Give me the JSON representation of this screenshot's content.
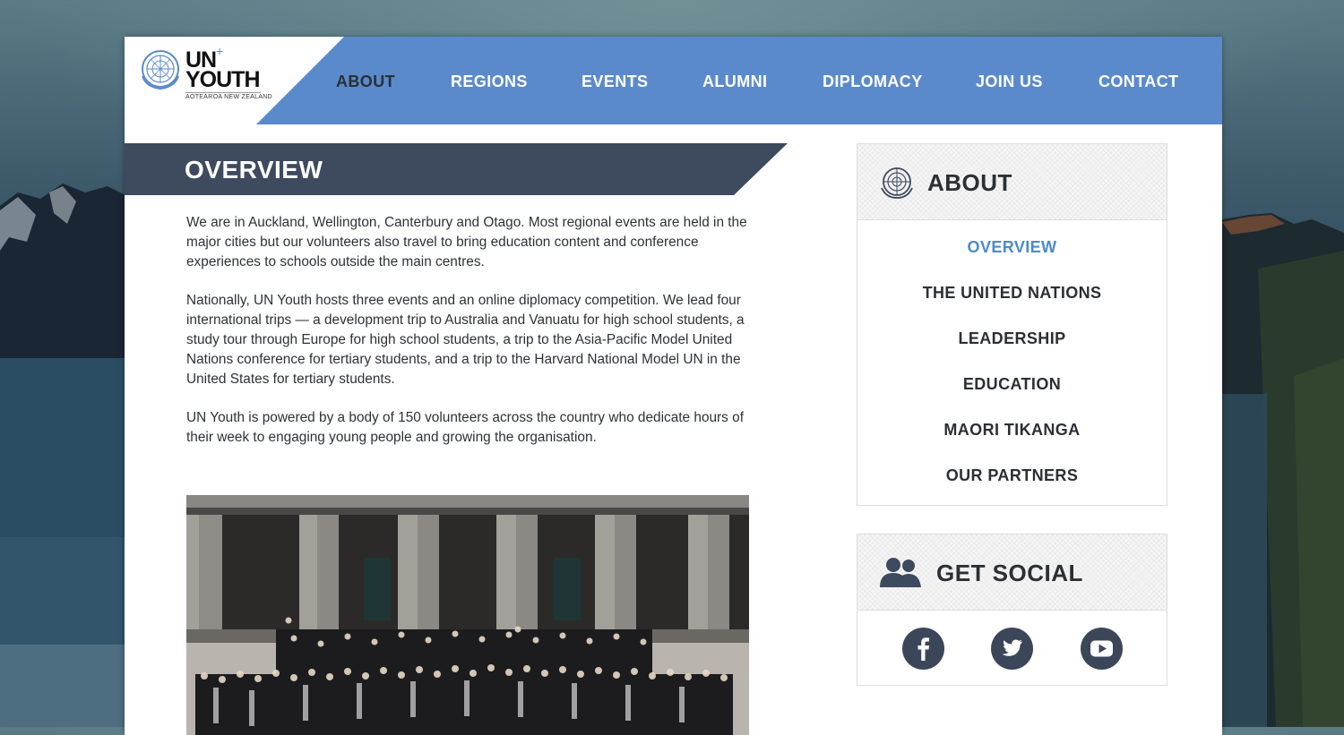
{
  "brand": {
    "logo_un": "UN",
    "logo_youth": "YOUTH",
    "logo_plus": "+",
    "logo_sub": "AOTEAROA NEW ZEALAND"
  },
  "nav": {
    "items": [
      {
        "label": "ABOUT",
        "active": true
      },
      {
        "label": "REGIONS"
      },
      {
        "label": "EVENTS"
      },
      {
        "label": "ALUMNI"
      },
      {
        "label": "DIPLOMACY"
      },
      {
        "label": "JOIN US"
      },
      {
        "label": "CONTACT"
      }
    ]
  },
  "main": {
    "title": "OVERVIEW",
    "paragraphs": [
      "We are in Auckland, Wellington, Canterbury and Otago. Most regional events are held in the major cities but our volunteers also travel to bring education content and conference experiences to schools outside the main centres.",
      "Nationally, UN Youth hosts three events and an online diplomacy competition. We lead four international trips — a development trip to Australia and Vanuatu for high school students, a study tour through Europe for high school students, a trip to the Asia-Pacific Model United Nations conference for tertiary students, and a trip to the Harvard National Model UN in the United States for tertiary students.",
      "UN Youth is powered by a body of 150 volunteers across the country who dedicate hours of their week to engaging young people and growing the organisation."
    ]
  },
  "sidebar": {
    "about": {
      "title": "ABOUT",
      "icon": "un-emblem-icon",
      "links": [
        {
          "label": "OVERVIEW",
          "active": true
        },
        {
          "label": "THE UNITED NATIONS"
        },
        {
          "label": "LEADERSHIP"
        },
        {
          "label": "EDUCATION"
        },
        {
          "label": "MAORI TIKANGA"
        },
        {
          "label": "OUR PARTNERS"
        }
      ]
    },
    "social": {
      "title": "GET SOCIAL",
      "icon": "people-icon",
      "buttons": [
        "facebook-icon",
        "twitter-icon",
        "youtube-icon"
      ]
    }
  },
  "colors": {
    "nav_blue": "#5a8acb",
    "banner_dark": "#3e4a5e",
    "active_link": "#4b8bcb",
    "text_dark": "#2b2f36",
    "social_circle": "#3c4659"
  }
}
